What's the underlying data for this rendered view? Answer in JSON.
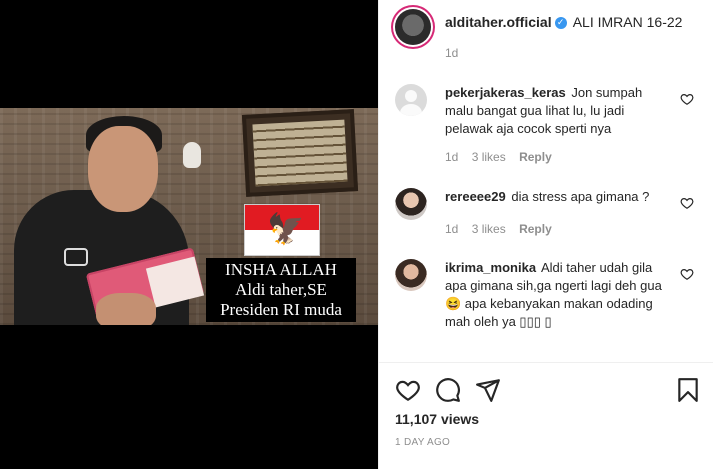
{
  "video": {
    "caption_lines": [
      "INSHA ALLAH",
      "Aldi taher,SE",
      "Presiden RI muda"
    ]
  },
  "post": {
    "username": "alditaher.official",
    "caption": "ALI IMRAN 16-22",
    "time": "1d",
    "verified_icon": "verified-badge-icon"
  },
  "comments": [
    {
      "username": "pekerjakeras_keras",
      "text": "Jon sumpah malu bangat gua lihat lu, lu jadi pelawak aja cocok sperti nya",
      "time": "1d",
      "likes": "3 likes",
      "reply": "Reply"
    },
    {
      "username": "rereeee29",
      "text": "dia stress apa gimana ?",
      "time": "1d",
      "likes": "3 likes",
      "reply": "Reply"
    },
    {
      "username": "ikrima_monika",
      "text": "Aldi taher udah gila apa gimana sih,ga ngerti lagi deh gua 😆 apa kebanyakan makan odading mah oleh ya ▯▯▯ ▯"
    }
  ],
  "footer": {
    "views": "11,107 views",
    "ago": "1 DAY AGO"
  },
  "colors": {
    "verified": "#3897f0",
    "meta_gray": "#8e8e8e",
    "text": "#262626"
  }
}
